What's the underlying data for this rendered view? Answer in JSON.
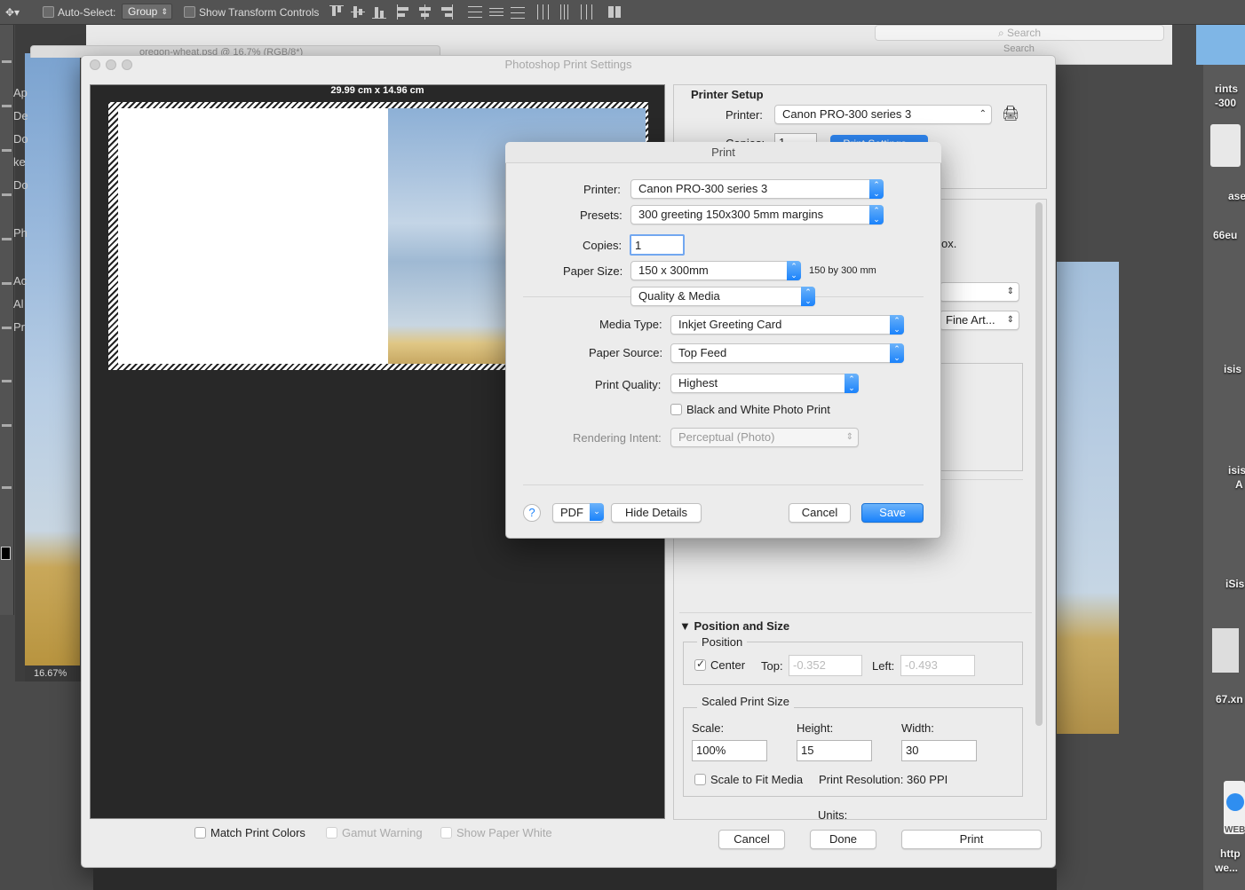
{
  "optionsbar": {
    "auto_select_label": "Auto-Select:",
    "auto_select_value": "Group",
    "show_transform_label": "Show Transform Controls"
  },
  "finder": {
    "search_placeholder": "Search",
    "search_label": "Search"
  },
  "background_doc": {
    "tab_title": "oregon-wheat.psd @ 16.7% (RGB/8*)",
    "zoom": "16.67%",
    "panel_fragments": [
      "Ap",
      "De",
      "Do",
      "ke",
      "Do",
      "Ph",
      "Ac",
      "Al",
      "Pr"
    ]
  },
  "desktop_right": {
    "labels": [
      "rints",
      "-300",
      "ase",
      "66eu",
      "isis",
      "isis",
      "A",
      "iSis",
      "67.xn",
      "WEB",
      "http",
      "we..."
    ]
  },
  "print_settings": {
    "title": "Photoshop Print Settings",
    "preview_dimensions": "29.99 cm x 14.96 cm",
    "printer_setup_heading": "Printer Setup",
    "printer_label": "Printer:",
    "printer_value": "Canon PRO-300 series 3",
    "copies_label": "Copies:",
    "copies_value": "1",
    "print_settings_button": "Print Settings...",
    "hidden_text_box": "ox.",
    "hidden_fine_art": "Fine Art...",
    "position_size_heading": "Position and Size",
    "position_group": "Position",
    "center_label": "Center",
    "center_checked": true,
    "top_label": "Top:",
    "top_value": "-0.352",
    "left_label": "Left:",
    "left_value": "-0.493",
    "scaled_group": "Scaled Print Size",
    "scale_label": "Scale:",
    "scale_value": "100%",
    "height_label": "Height:",
    "height_value": "15",
    "width_label": "Width:",
    "width_value": "30",
    "scale_to_fit_label": "Scale to Fit Media",
    "print_resolution": "Print Resolution: 360 PPI",
    "units_label": "Units:",
    "match_print_colors": "Match Print Colors",
    "gamut_warning": "Gamut Warning",
    "show_paper_white": "Show Paper White",
    "cancel": "Cancel",
    "done": "Done",
    "print": "Print"
  },
  "print_dialog": {
    "title": "Print",
    "printer_label": "Printer:",
    "printer_value": "Canon PRO-300 series 3",
    "presets_label": "Presets:",
    "presets_value": "300 greeting 150x300 5mm margins",
    "copies_label": "Copies:",
    "copies_value": "1",
    "paper_size_label": "Paper Size:",
    "paper_size_value": "150 x 300mm",
    "paper_size_note": "150 by 300 mm",
    "pane_value": "Quality & Media",
    "media_type_label": "Media Type:",
    "media_type_value": "Inkjet Greeting Card",
    "paper_source_label": "Paper Source:",
    "paper_source_value": "Top Feed",
    "print_quality_label": "Print Quality:",
    "print_quality_value": "Highest",
    "bw_photo_label": "Black and White Photo Print",
    "rendering_intent_label": "Rendering Intent:",
    "rendering_intent_value": "Perceptual (Photo)",
    "help": "?",
    "pdf": "PDF",
    "hide_details": "Hide Details",
    "cancel": "Cancel",
    "save": "Save"
  }
}
